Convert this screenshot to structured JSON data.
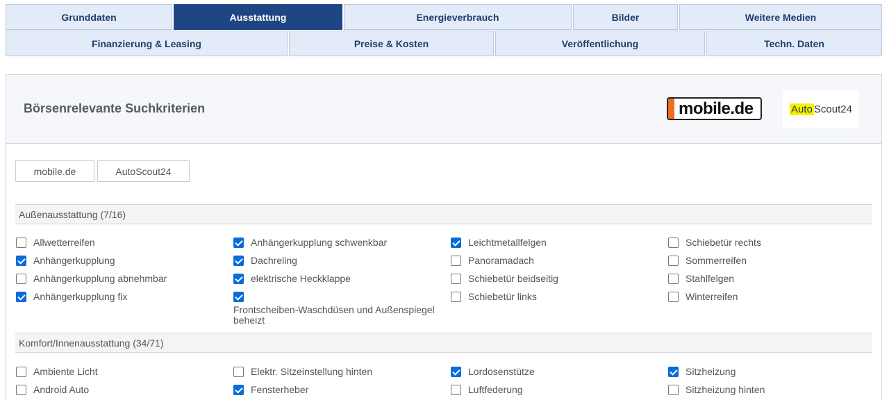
{
  "tabs": {
    "row1": [
      {
        "label": "Grunddaten",
        "active": false
      },
      {
        "label": "Ausstattung",
        "active": true
      },
      {
        "label": "Energieverbrauch",
        "active": false
      },
      {
        "label": "Bilder",
        "active": false
      },
      {
        "label": "Weitere Medien",
        "active": false
      }
    ],
    "row2": [
      {
        "label": "Finanzierung & Leasing",
        "active": false
      },
      {
        "label": "Preise & Kosten",
        "active": false
      },
      {
        "label": "Veröffentlichung",
        "active": false
      },
      {
        "label": "Techn. Daten",
        "active": false
      }
    ]
  },
  "panel": {
    "title": "Börsenrelevante Suchkriterien",
    "logo_mobile": "mobile.de",
    "logo_as24_auto": "Auto",
    "logo_as24_scout": "Scout24"
  },
  "filters": {
    "mobile": "mobile.de",
    "autoscout": "AutoScout24"
  },
  "sections": [
    {
      "title": "Außenausstattung (7/16)",
      "columns": [
        [
          {
            "label": "Allwetterreifen",
            "checked": false
          },
          {
            "label": "Anhängerkupplung",
            "checked": true
          },
          {
            "label": "Anhängerkupplung abnehmbar",
            "checked": false
          },
          {
            "label": "Anhängerkupplung fix",
            "checked": true
          }
        ],
        [
          {
            "label": "Anhängerkupplung schwenkbar",
            "checked": true
          },
          {
            "label": "Dachreling",
            "checked": true
          },
          {
            "label": "elektrische Heckklappe",
            "checked": true
          },
          {
            "label": "Frontscheiben-Waschdüsen und Außenspiegel beheizt",
            "checked": true
          }
        ],
        [
          {
            "label": "Leichtmetallfelgen",
            "checked": true
          },
          {
            "label": "Panoramadach",
            "checked": false
          },
          {
            "label": "Schiebetür beidseitig",
            "checked": false
          },
          {
            "label": "Schiebetür links",
            "checked": false
          }
        ],
        [
          {
            "label": "Schiebetür rechts",
            "checked": false
          },
          {
            "label": "Sommerreifen",
            "checked": false
          },
          {
            "label": "Stahlfelgen",
            "checked": false
          },
          {
            "label": "Winterreifen",
            "checked": false
          }
        ]
      ]
    },
    {
      "title": "Komfort/Innenausstattung (34/71)",
      "columns": [
        [
          {
            "label": "Ambiente Licht",
            "checked": false
          },
          {
            "label": "Android Auto",
            "checked": false
          }
        ],
        [
          {
            "label": "Elektr. Sitzeinstellung hinten",
            "checked": false
          },
          {
            "label": "Fensterheber",
            "checked": true
          }
        ],
        [
          {
            "label": "Lordosenstütze",
            "checked": true
          },
          {
            "label": "Luftfederung",
            "checked": false
          }
        ],
        [
          {
            "label": "Sitzheizung",
            "checked": true
          },
          {
            "label": "Sitzheizung hinten",
            "checked": false
          }
        ]
      ]
    }
  ]
}
